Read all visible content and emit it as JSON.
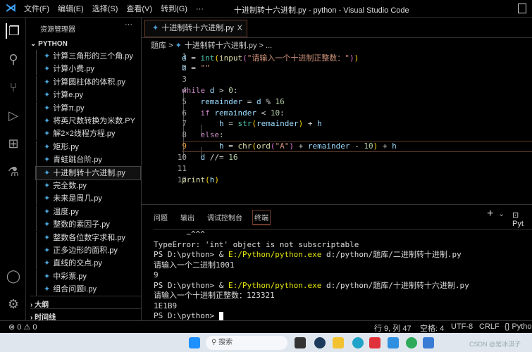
{
  "titlebar": {
    "menus": [
      "文件(F)",
      "编辑(E)",
      "选择(S)",
      "查看(V)",
      "转到(G)",
      "···"
    ],
    "title": "十进制转十六进制.py - python - Visual Studio Code"
  },
  "sidebar": {
    "header": "资源管理器",
    "more": "···",
    "project": "PYTHON",
    "files": [
      "计算三角形的三个角.py",
      "计算小费.py",
      "计算圆柱体的体积.py",
      "计算e.py",
      "计算π.py",
      "将英尺数转换为米数.PY",
      "解2×2线程方程.py",
      "矩形.py",
      "青蛙跳台阶.py",
      "十进制转十六进制.py",
      "完全数.py",
      "未来是周几.py",
      "温度.py",
      "整数的素因子.py",
      "整数各位数字求和.py",
      "正多边形的面积.py",
      "直线的交点.py",
      "中彩票.py",
      "组合问题I.py"
    ],
    "active_index": 9,
    "outline": "大纲",
    "timeline": "时间线"
  },
  "editor": {
    "tab_label": "十进制转十六进制.py",
    "close": "X",
    "breadcrumb": [
      "题库",
      ">",
      "十进制转十六进制.py",
      ">",
      "..."
    ],
    "current_line": 9,
    "lines": [
      [
        [
          "v",
          "d"
        ],
        [
          "o",
          " = "
        ],
        [
          "t",
          "int"
        ],
        [
          "p",
          "("
        ],
        [
          "f",
          "input"
        ],
        [
          "p2",
          "("
        ],
        [
          "s",
          "\"请输入一个十进制正整数：\""
        ],
        [
          "p2",
          ")"
        ],
        [
          "p",
          ")"
        ]
      ],
      [
        [
          "v",
          "h"
        ],
        [
          "o",
          " = "
        ],
        [
          "s",
          "\"\""
        ]
      ],
      [],
      [
        [
          "k",
          "while"
        ],
        [
          "v",
          " d"
        ],
        [
          "o",
          " > "
        ],
        [
          "n",
          "0"
        ],
        [
          "o",
          ":"
        ]
      ],
      [
        [
          "o",
          "    "
        ],
        [
          "v",
          "remainder"
        ],
        [
          "o",
          " = "
        ],
        [
          "v",
          "d"
        ],
        [
          "o",
          " % "
        ],
        [
          "n",
          "16"
        ]
      ],
      [
        [
          "o",
          "    "
        ],
        [
          "k",
          "if"
        ],
        [
          "v",
          " remainder"
        ],
        [
          "o",
          " < "
        ],
        [
          "n",
          "10"
        ],
        [
          "o",
          ":"
        ]
      ],
      [
        [
          "o",
          "        "
        ],
        [
          "v",
          "h"
        ],
        [
          "o",
          " = "
        ],
        [
          "t",
          "str"
        ],
        [
          "p",
          "("
        ],
        [
          "v",
          "remainder"
        ],
        [
          "p",
          ")"
        ],
        [
          "o",
          " + "
        ],
        [
          "v",
          "h"
        ]
      ],
      [
        [
          "o",
          "    "
        ],
        [
          "k",
          "else"
        ],
        [
          "o",
          ":"
        ]
      ],
      [
        [
          "o",
          "        "
        ],
        [
          "v",
          "h"
        ],
        [
          "o",
          " = "
        ],
        [
          "f",
          "chr"
        ],
        [
          "p",
          "("
        ],
        [
          "f",
          "ord"
        ],
        [
          "p2",
          "("
        ],
        [
          "s",
          "\"A\""
        ],
        [
          "p2",
          ")"
        ],
        [
          "o",
          " + "
        ],
        [
          "v",
          "remainder"
        ],
        [
          "o",
          " - "
        ],
        [
          "n",
          "10"
        ],
        [
          "p",
          ")"
        ],
        [
          "o",
          " + "
        ],
        [
          "v",
          "h"
        ]
      ],
      [
        [
          "o",
          "    "
        ],
        [
          "v",
          "d"
        ],
        [
          "o",
          " //= "
        ],
        [
          "n",
          "16"
        ]
      ],
      [],
      [
        [
          "f",
          "print"
        ],
        [
          "p",
          "("
        ],
        [
          "v",
          "h"
        ],
        [
          "p",
          ")"
        ]
      ]
    ]
  },
  "panel": {
    "tabs": [
      "问题",
      "输出",
      "调试控制台",
      "终端"
    ],
    "selected": "终端",
    "actions": [
      "+",
      "⌄",
      "Pyt"
    ],
    "terminal": [
      [
        [
          "",
          "       ~^^^"
        ]
      ],
      [
        [
          "",
          "TypeError: 'int' object is not subscriptable"
        ]
      ],
      [
        [
          "",
          "PS D:\\python> & "
        ],
        [
          "y",
          "E:/Python/python.exe"
        ],
        [
          "",
          " d:/python/题库/二进制转十进制.py"
        ]
      ],
      [
        [
          "",
          "请输入一个二进制1001"
        ]
      ],
      [
        [
          "",
          "9"
        ]
      ],
      [
        [
          "",
          "PS D:\\python> & "
        ],
        [
          "y",
          "E:/Python/python.exe"
        ],
        [
          "",
          " d:/python/题库/十进制转十六进制.py"
        ]
      ],
      [
        [
          "",
          "请输入一个十进制正整数：123321"
        ]
      ],
      [
        [
          "",
          "1E1B9"
        ]
      ],
      [
        [
          "",
          "PS D:\\python> "
        ]
      ]
    ]
  },
  "status": {
    "problems": "⊗ 0 ⚠ 0",
    "position": "行 9, 列 47",
    "spaces": "空格: 4",
    "encoding": "UTF-8",
    "eol": "CRLF",
    "language": "{} Python"
  },
  "taskbar": {
    "search": "搜索",
    "watermark": "CSDN @是冰淇子"
  }
}
